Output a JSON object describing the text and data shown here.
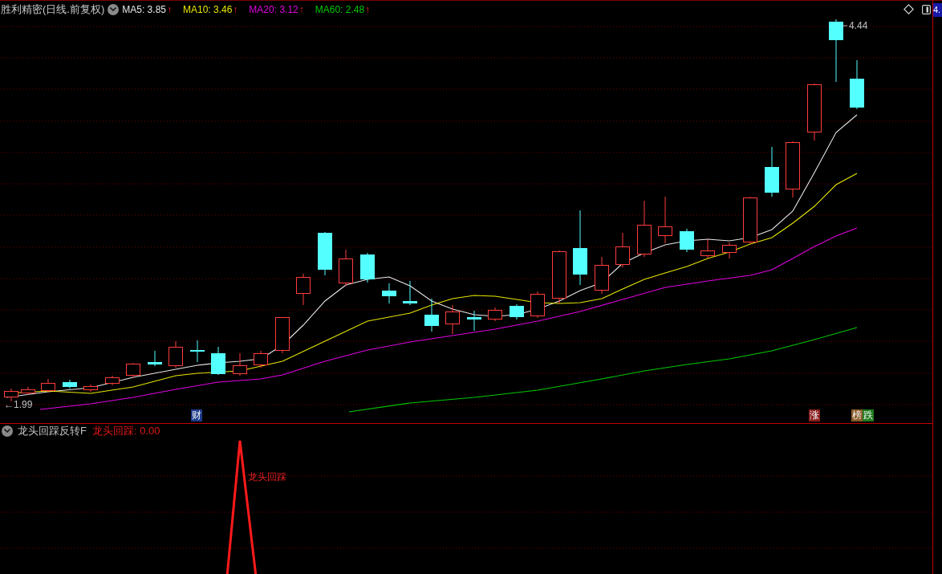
{
  "header": {
    "title": "胜利精密(日线.前复权)",
    "indicators": [
      {
        "label": "MA5: 3.85",
        "arrow": "↑",
        "color": "#e6e6e6"
      },
      {
        "label": "MA10: 3.46",
        "arrow": "↑",
        "color": "#e6e600"
      },
      {
        "label": "MA20: 3.12",
        "arrow": "↑",
        "color": "#e000e0"
      },
      {
        "label": "MA60: 2.48",
        "arrow": "↑",
        "color": "#00c800"
      }
    ]
  },
  "price_axis": {
    "label": "4."
  },
  "chart": {
    "high_label": "4.44",
    "low_label": "←1.99",
    "markers": [
      {
        "text": "财",
        "color": "#1e3c8c"
      },
      {
        "text": "涨",
        "color": "#8a1e1e"
      },
      {
        "text": "榜",
        "color": "#8a5a28"
      },
      {
        "text": "跌",
        "color": "#1e7a1e"
      }
    ]
  },
  "indicator_panel": {
    "name": "龙头回踩反转F",
    "reading": "龙头回踩: 0.00",
    "signal_label": "龙头回踩"
  }
}
